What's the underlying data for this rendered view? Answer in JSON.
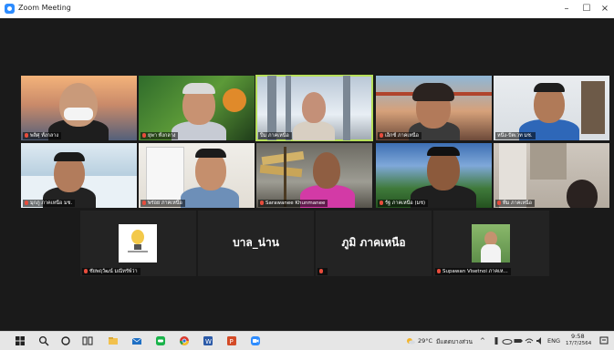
{
  "window": {
    "title": "Zoom Meeting",
    "minimize": "–",
    "maximize": "☐",
    "close": "×"
  },
  "gallery": {
    "row1": [
      {
        "name": "พลิศุ ทั้งกลาง"
      },
      {
        "name": "ยุพา ทั้งกลาง"
      },
      {
        "name": "ปิ้ม ภาคเหนือ"
      },
      {
        "name": "เอ็กซ์ ภาคเหนือ"
      },
      {
        "name": "หนึ่ง-ปัตเวท มช."
      }
    ],
    "row2": [
      {
        "name": "มุกภู ภาคเหนือ มช."
      },
      {
        "name": "พร่อย ภาคเหนือ"
      },
      {
        "name": "Sarawanee Khunmanee"
      },
      {
        "name": "รัฐ ภาคเหนือ (มช)"
      },
      {
        "name": "ทีม ภาคเหนือ"
      }
    ],
    "row3": [
      {
        "name": "ชัยพฤวัฒน์ มณีทรัพ์ว่า",
        "big": ""
      },
      {
        "name": "",
        "big": "บาล_น่าน"
      },
      {
        "name": "",
        "big": "ภูมิ ภาคเหนือ"
      },
      {
        "name": "Supawan Visetnoi ภาคเห...",
        "big": ""
      }
    ]
  },
  "taskbar": {
    "weather": "29°C",
    "weather_text": "มีแดดบางส่วน",
    "lang": "ENG",
    "time": "9:58",
    "date": "17/7/2564"
  }
}
